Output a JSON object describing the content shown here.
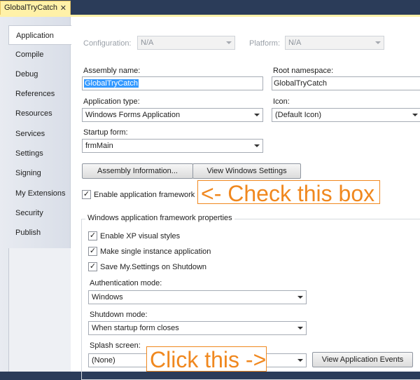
{
  "doc_tab": {
    "title": "GlobalTryCatch",
    "close": "✕"
  },
  "nav": {
    "items": [
      "Application",
      "Compile",
      "Debug",
      "References",
      "Resources",
      "Services",
      "Settings",
      "Signing",
      "My Extensions",
      "Security",
      "Publish"
    ],
    "active": "Application"
  },
  "config": {
    "configuration_label": "Configuration:",
    "configuration_value": "N/A",
    "platform_label": "Platform:",
    "platform_value": "N/A"
  },
  "assembly": {
    "name_label": "Assembly name:",
    "name_value": "GlobalTryCatch",
    "root_ns_label": "Root namespace:",
    "root_ns_value": "GlobalTryCatch"
  },
  "app_type": {
    "label": "Application type:",
    "value": "Windows Forms Application",
    "icon_label": "Icon:",
    "icon_value": "(Default Icon)"
  },
  "startup": {
    "label": "Startup form:",
    "value": "frmMain"
  },
  "buttons": {
    "assembly_info": "Assembly Information...",
    "view_windows_settings": "View Windows Settings",
    "view_app_events": "View Application Events"
  },
  "framework": {
    "label": "Enable application framework",
    "checked": true
  },
  "callouts": {
    "check_box": "<- Check this box",
    "click_this": "Click this ->"
  },
  "group": {
    "title": "Windows application framework properties",
    "xp_styles": "Enable XP visual styles",
    "single_instance": "Make single instance application",
    "save_settings": "Save My.Settings on Shutdown",
    "auth_label": "Authentication mode:",
    "auth_value": "Windows",
    "shutdown_label": "Shutdown mode:",
    "shutdown_value": "When startup form closes",
    "splash_label": "Splash screen:",
    "splash_value": "(None)"
  },
  "colors": {
    "accent_callout": "#f0881f",
    "tab_yellow": "#fff1a8",
    "frame": "#2b3c59",
    "selection": "#3399ff"
  },
  "icons": {
    "check": "checkmark-icon",
    "dropdown": "chevron-down-icon",
    "close": "close-icon"
  }
}
